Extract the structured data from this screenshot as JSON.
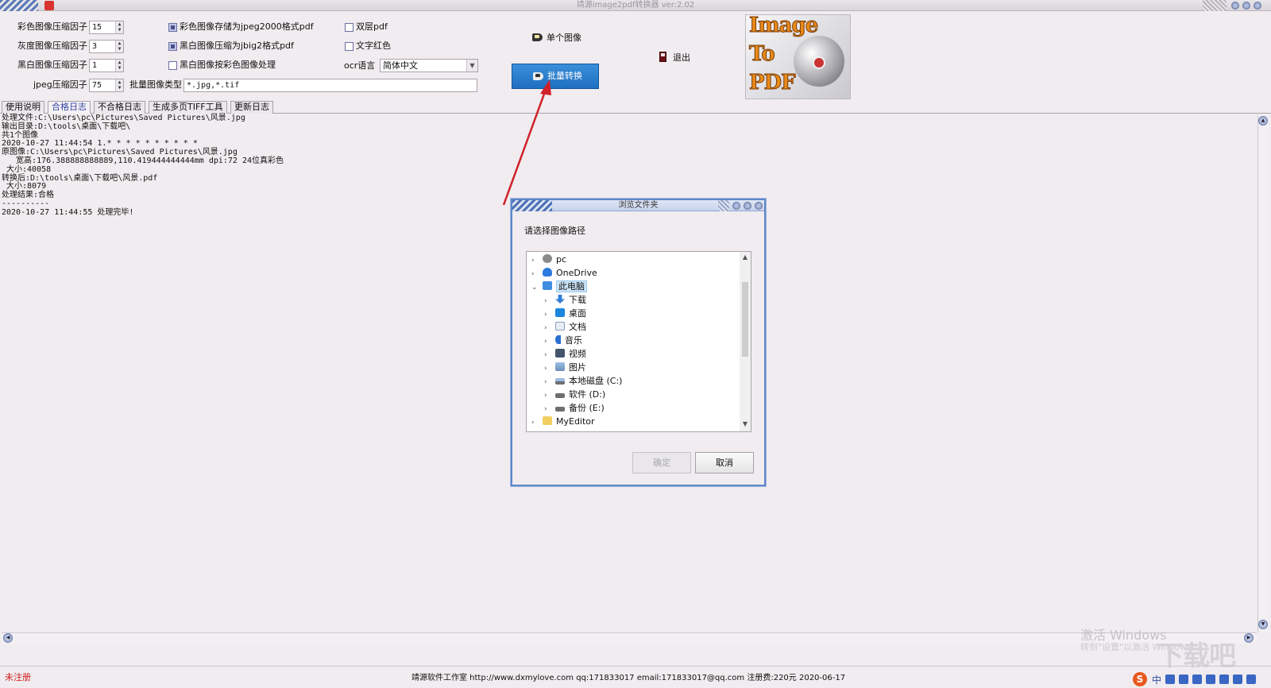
{
  "window": {
    "title": "靖源image2pdf转换器 ver:2.02"
  },
  "settings": {
    "color_factor_label": "彩色图像压缩因子",
    "color_factor_value": "15",
    "gray_factor_label": "灰度图像压缩因子",
    "gray_factor_value": "3",
    "bw_factor_label": "黑白图像压缩因子",
    "bw_factor_value": "1",
    "jpeg_factor_label": "jpeg压缩因子",
    "jpeg_factor_value": "75",
    "chk_jpeg2000": "彩色图像存储为jpeg2000格式pdf",
    "chk_jbig2": "黑白图像压缩为jbig2格式pdf",
    "chk_bw_as_color": "黑白图像按彩色图像处理",
    "chk_double_layer": "双层pdf",
    "chk_text_red": "文字红色",
    "ocr_label": "ocr语言",
    "ocr_value": "简体中文",
    "batch_type_label": "批量图像类型",
    "batch_type_value": "*.jpg,*.tif"
  },
  "actions": {
    "single": "单个图像",
    "batch": "批量转换",
    "exit": "退出"
  },
  "logo": {
    "line1": "Image",
    "line2": "To",
    "line3": "PDF"
  },
  "tabs": [
    "使用说明",
    "合格日志",
    "不合格日志",
    "生成多页TIFF工具",
    "更新日志"
  ],
  "log_lines": [
    "处理文件:C:\\Users\\pc\\Pictures\\Saved Pictures\\风景.jpg",
    "输出目录:D:\\tools\\桌面\\下载吧\\",
    "共1个图像",
    "2020-10-27 11:44:54 1.* * * * * * * * * *",
    "原图像:C:\\Users\\pc\\Pictures\\Saved Pictures\\风景.jpg",
    "   宽高:176.388888888889,110.419444444444mm dpi:72 24位真彩色",
    " 大小:40058",
    "转换后:D:\\tools\\桌面\\下载吧\\风景.pdf",
    " 大小:8079",
    "处理结果:合格",
    "----------",
    "2020-10-27 11:44:55 处理完毕!"
  ],
  "status": {
    "left": "未注册",
    "center": "靖源软件工作室 http://www.dxmylove.com qq:171833017 email:171833017@qq.com 注册费:220元 2020-06-17",
    "watermark_1": "激活 Windows",
    "watermark_2": "转到\"设置\"以激活 Windows。",
    "brand": "下载吧",
    "tray_ime": "中"
  },
  "dialog": {
    "title": "浏览文件夹",
    "prompt": "请选择图像路径",
    "tree": [
      "pc",
      "OneDrive",
      "此电脑",
      "下载",
      "桌面",
      "文档",
      "音乐",
      "视频",
      "图片",
      "本地磁盘 (C:)",
      "软件 (D:)",
      "备份 (E:)",
      "MyEditor"
    ],
    "ok": "确定",
    "cancel": "取消"
  },
  "colors": {
    "accent": "#1f6fc1",
    "annotation_arrow": "#d0212a",
    "unregistered": "#d11a1a"
  }
}
